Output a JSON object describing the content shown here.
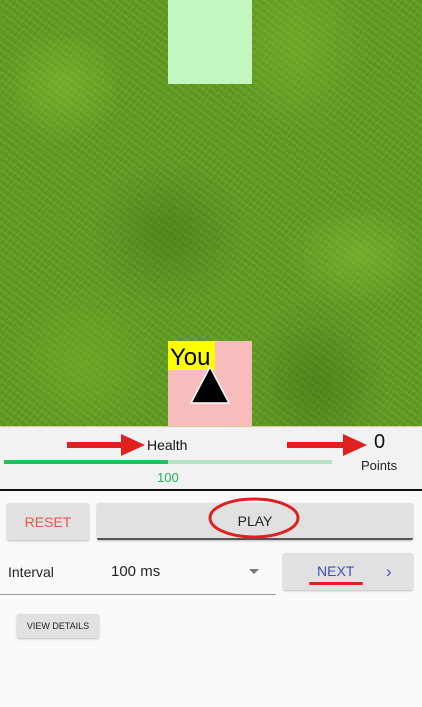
{
  "game": {
    "player_label": "You",
    "colors": {
      "target_block": "#c2f7c0",
      "player_block": "#f7bdbd",
      "player_label_bg": "#ffff00"
    }
  },
  "status": {
    "health_label": "Health",
    "health_value": "100",
    "health_fraction": 0.5,
    "points_value": "0",
    "points_label": "Points",
    "colors": {
      "health_bar": "#22c061",
      "annotation": "#e02020"
    }
  },
  "controls": {
    "reset_label": "RESET",
    "play_label": "PLAY",
    "interval_label": "Interval",
    "interval_value": "100 ms",
    "next_label": "NEXT",
    "next_icon": "chevron-right-icon",
    "details_label": "VIEW DETAILS",
    "colors": {
      "reset_text": "#ef5350",
      "next_text": "#3f51b5"
    }
  }
}
